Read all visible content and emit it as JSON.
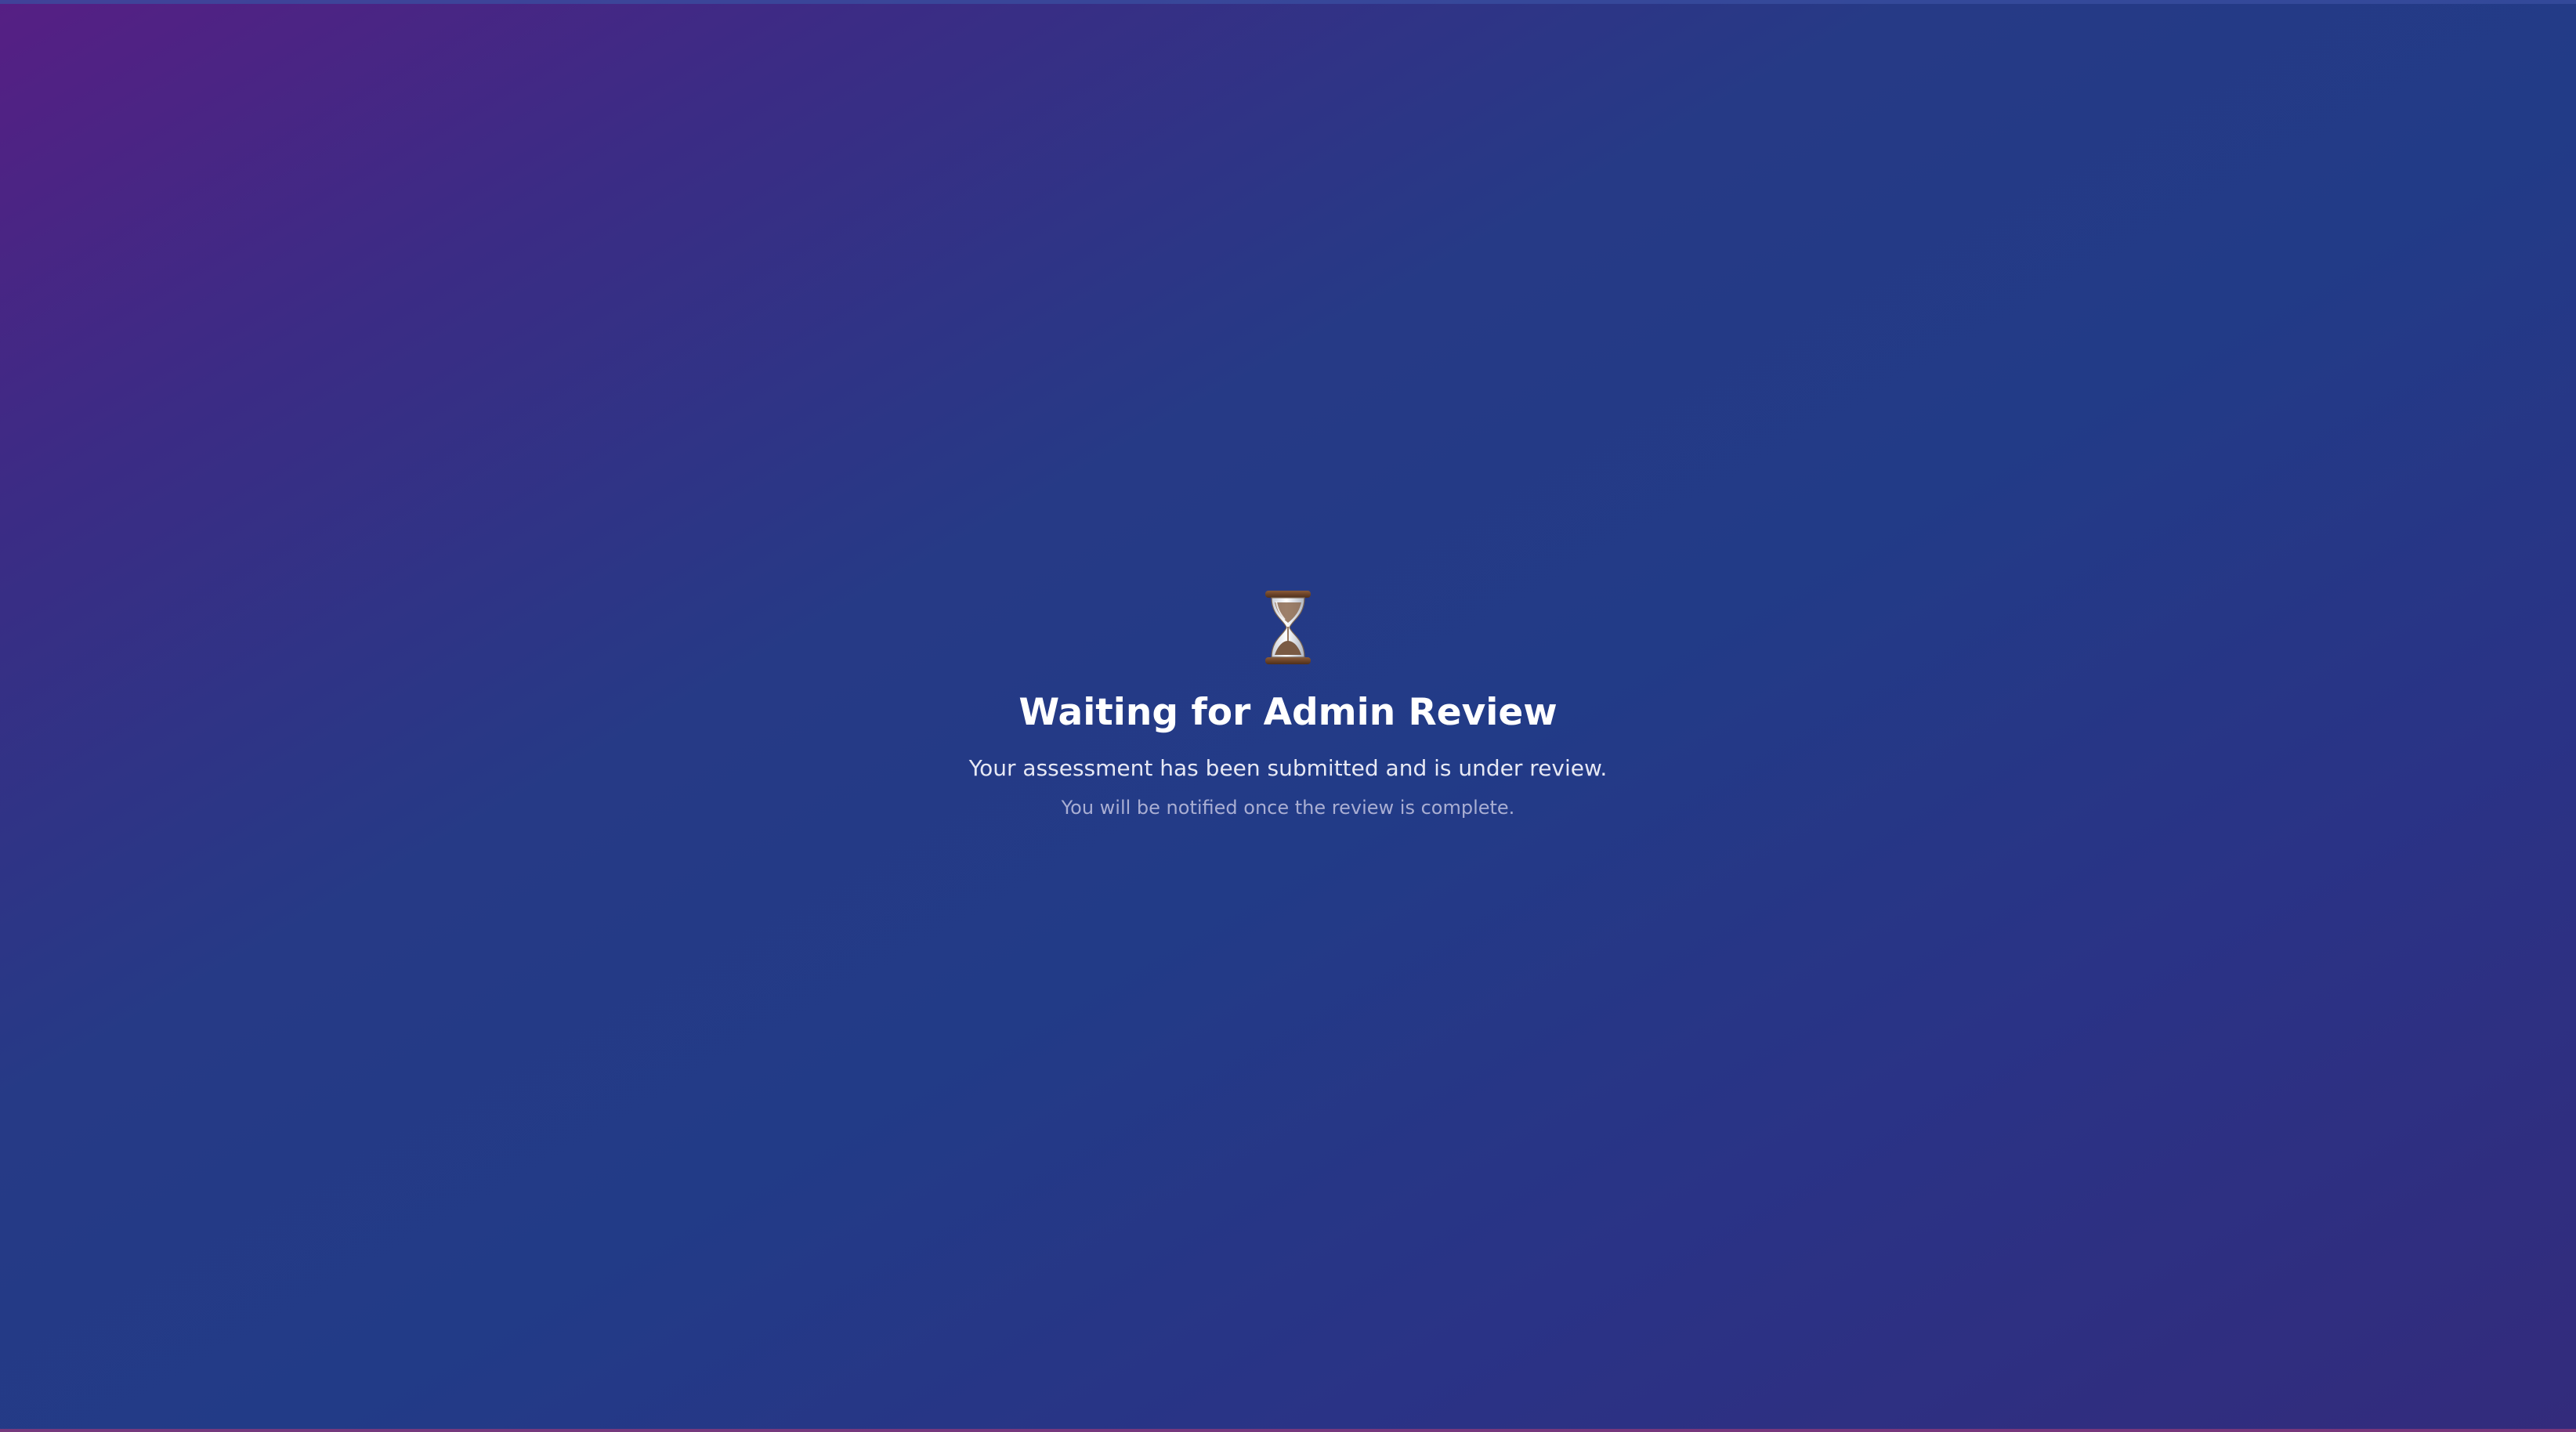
{
  "page": {
    "icon": "hourglass-icon",
    "title": "Waiting for Admin Review",
    "subtitle": "Your assessment has been submitted and is under review.",
    "note": "You will be notified once the review is complete."
  },
  "colors": {
    "background_start": "#561f84",
    "background_mid": "#223b87",
    "background_end": "#332b7c",
    "title": "#ffffff",
    "subtitle": "#e6e8f4",
    "note": "#a9aed3"
  }
}
